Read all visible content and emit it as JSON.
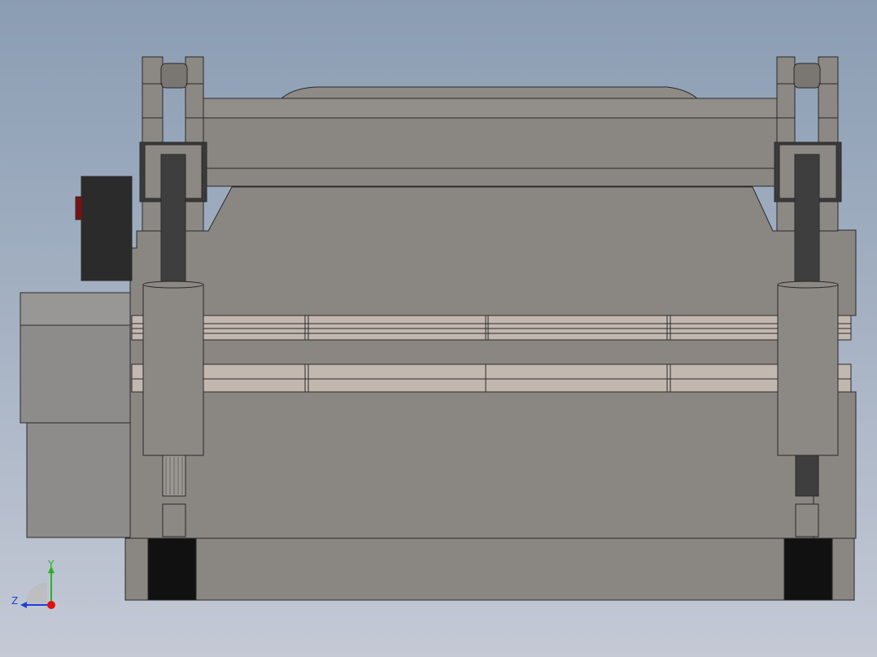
{
  "viewport": {
    "background_top": "#8b9db3",
    "background_bottom": "#c4c9d5",
    "model_name": ""
  },
  "model": {
    "body_color": "#8a8682",
    "edge_color": "#2a2a2a",
    "rail_color": "#c2b8b0",
    "dark_part_color": "#2b2b2b",
    "foot_color": "#111111",
    "cylinder_rod_color": "#3e3e3e"
  },
  "triad": {
    "y_label": "Y",
    "z_label": "Z",
    "y_color": "#2bb02b",
    "z_color": "#1f3fd6",
    "x_color": "#e01010",
    "icon": "coordinate-triad-icon"
  }
}
